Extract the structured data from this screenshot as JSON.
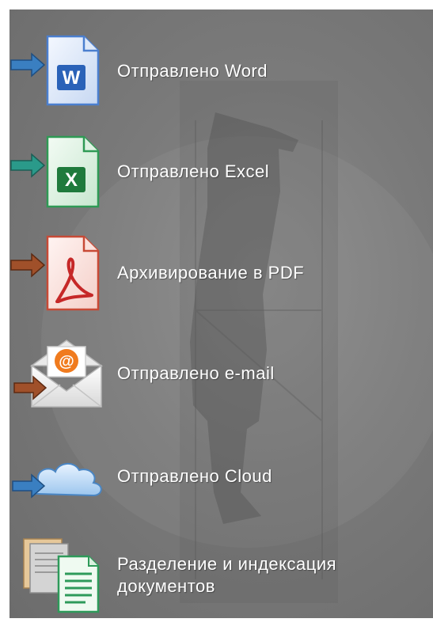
{
  "menu": {
    "items": [
      {
        "label": "Отправлено Word",
        "icon": "word-icon"
      },
      {
        "label": "Отправлено Excel",
        "icon": "excel-icon"
      },
      {
        "label": "Архивирование в PDF",
        "icon": "pdf-icon"
      },
      {
        "label": "Отправлено e-mail",
        "icon": "email-icon"
      },
      {
        "label": "Отправлено Cloud",
        "icon": "cloud-icon"
      },
      {
        "label": "Разделение и индексация документов",
        "icon": "split-documents-icon"
      }
    ]
  },
  "colors": {
    "panel": "#7a7a7a",
    "text": "#ffffff",
    "word": "#2a62b8",
    "excel": "#1f7a3c",
    "pdf": "#c62828",
    "email_badge": "#f07b1e",
    "arrow_blue": "#3a7fc1",
    "arrow_teal": "#2a9a8a",
    "arrow_brown": "#a0502a"
  }
}
